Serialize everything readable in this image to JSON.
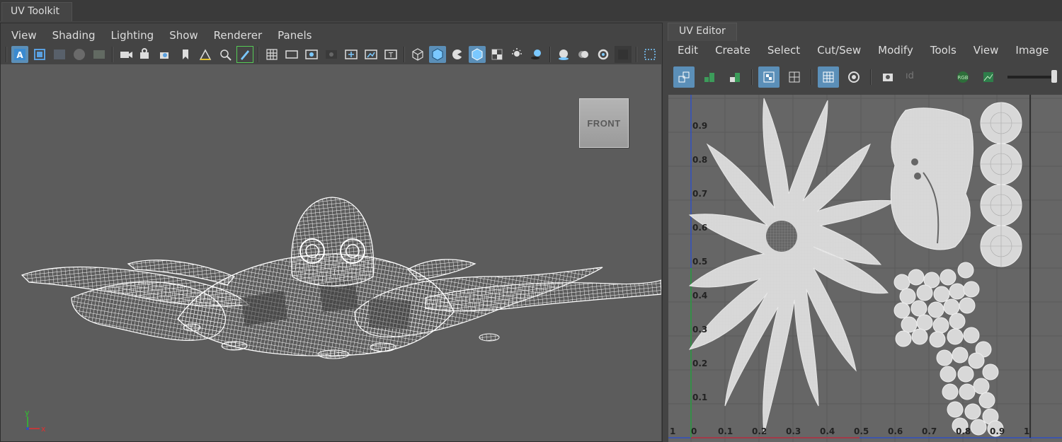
{
  "app_tab": {
    "title": "UV Toolkit"
  },
  "viewport": {
    "menu": [
      "View",
      "Shading",
      "Lighting",
      "Show",
      "Renderer",
      "Panels"
    ],
    "view_cube_label": "FRONT",
    "axis": {
      "y": "y",
      "x": "x"
    },
    "toolbar_icons": [
      "select-camera-icon",
      "image-plane-icon",
      "grid-camera-icon",
      "shaded-ball-icon",
      "textured-ball-icon",
      "camera-icon",
      "camera-lock-icon",
      "camera-attributes-icon",
      "bookmark-icon",
      "2d-pan-zoom-icon",
      "grease-pencil-icon",
      "edit-pencil-icon",
      "grid-icon",
      "film-gate-icon",
      "resolution-gate-icon",
      "gate-mask-icon",
      "field-chart-icon",
      "safe-action-icon",
      "safe-title-icon",
      "wireframe-icon",
      "smooth-shade-icon",
      "default-material-icon",
      "wireframe-on-shaded-icon",
      "xray-icon",
      "lighting-icon",
      "shadows-icon",
      "ambient-occlusion-icon",
      "motion-blur-icon",
      "anti-aliasing-icon",
      "depth-of-field-icon",
      "isolate-select-icon"
    ],
    "colors": {
      "canvas": "#5c5c5c",
      "active_icon": "#5b8fb8",
      "wireframe": "#ffffff"
    }
  },
  "uv_editor": {
    "tab_title": "UV Editor",
    "menu": [
      "Edit",
      "Create",
      "Select",
      "Cut/Sew",
      "Modify",
      "Tools",
      "View",
      "Image"
    ],
    "toolbar_icons": [
      "uv-shell-select-icon",
      "stack-icon",
      "orient-icon",
      "isolate-uv-icon",
      "uv-grid-icon",
      "checker-icon",
      "distortion-icon",
      "snapshot-icon",
      "rgb-channels-icon",
      "texture-display-icon",
      "exposure-slider-icon",
      "more-icon"
    ],
    "field_placeholder": "ıd",
    "rgb_label": "RGB",
    "u_axis_ticks": [
      "1",
      "0",
      "0.1",
      "0.2",
      "0.3",
      "0.4",
      "0.5",
      "0.6",
      "0.7",
      "0.8",
      "0.9",
      "1"
    ],
    "v_axis_ticks": [
      "0.9",
      "0.8",
      "0.7",
      "0.6",
      "0.5",
      "0.4",
      "0.3",
      "0.2",
      "0.1"
    ],
    "colors": {
      "canvas": "#666666",
      "shell_fill": "#d8d8d8",
      "u_axis": "#c03030",
      "v_axis": "#30a030",
      "frame_axis": "#3050c0"
    }
  }
}
